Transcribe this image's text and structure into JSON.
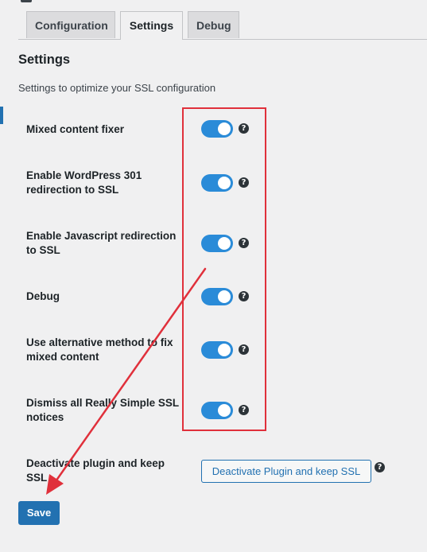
{
  "tabs": [
    {
      "label": "Configuration",
      "active": false
    },
    {
      "label": "Settings",
      "active": true
    },
    {
      "label": "Debug",
      "active": false
    }
  ],
  "section": {
    "title": "Settings",
    "description": "Settings to optimize your SSL configuration"
  },
  "settings": [
    {
      "label": "Mixed content fixer",
      "enabled": true,
      "help": "?"
    },
    {
      "label": "Enable WordPress 301 redirection to SSL",
      "enabled": true,
      "help": "?"
    },
    {
      "label": "Enable Javascript redirection to SSL",
      "enabled": true,
      "help": "?"
    },
    {
      "label": "Debug",
      "enabled": true,
      "help": "?"
    },
    {
      "label": "Use alternative method to fix mixed content",
      "enabled": true,
      "help": "?"
    },
    {
      "label": "Dismiss all Really Simple SSL notices",
      "enabled": true,
      "help": "?"
    }
  ],
  "deactivate": {
    "label": "Deactivate plugin and keep SSL",
    "button_label": "Deactivate Plugin and keep SSL",
    "help": "?"
  },
  "save_label": "Save",
  "colors": {
    "accent": "#2271b1",
    "toggle_on": "#2a8bd8",
    "annotation": "#e0303b"
  }
}
